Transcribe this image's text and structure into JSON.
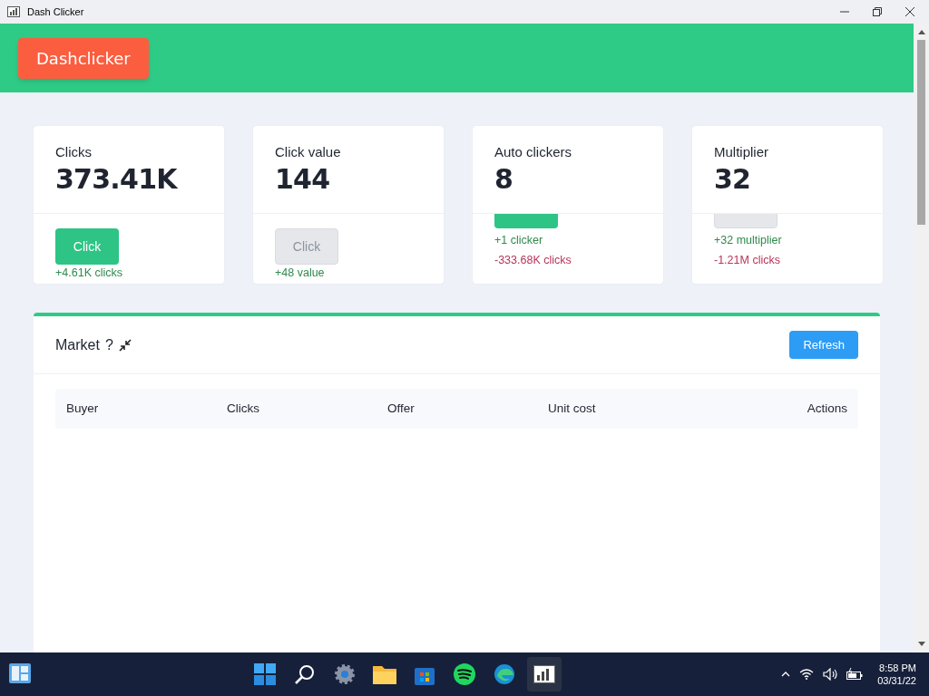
{
  "window": {
    "title": "Dash Clicker"
  },
  "brand": "Dashclicker",
  "cards": [
    {
      "label": "Clicks",
      "value": "373.41K",
      "scrolled": false,
      "button": {
        "label": "Click",
        "disabled": false
      },
      "notes": [
        {
          "kind": "gain",
          "text": "+4.61K clicks"
        }
      ]
    },
    {
      "label": "Click value",
      "value": "144",
      "scrolled": false,
      "button": {
        "label": "Click",
        "disabled": true
      },
      "notes": [
        {
          "kind": "gain",
          "text": "+48 value"
        }
      ]
    },
    {
      "label": "Auto clickers",
      "value": "8",
      "scrolled": true,
      "button": {
        "disabled": false
      },
      "notes": [
        {
          "kind": "gain",
          "text": "+1 clicker"
        },
        {
          "kind": "cost",
          "text": "-333.68K clicks"
        }
      ]
    },
    {
      "label": "Multiplier",
      "value": "32",
      "scrolled": true,
      "button": {
        "disabled": true
      },
      "notes": [
        {
          "kind": "gain",
          "text": "+32 multiplier"
        },
        {
          "kind": "cost",
          "text": "-1.21M clicks"
        }
      ]
    }
  ],
  "market": {
    "title": "Market",
    "help": "?",
    "refresh": "Refresh",
    "columns": [
      "Buyer",
      "Clicks",
      "Offer",
      "Unit cost",
      "Actions"
    ]
  },
  "taskbar": {
    "time": "8:58 PM",
    "date": "03/31/22"
  }
}
